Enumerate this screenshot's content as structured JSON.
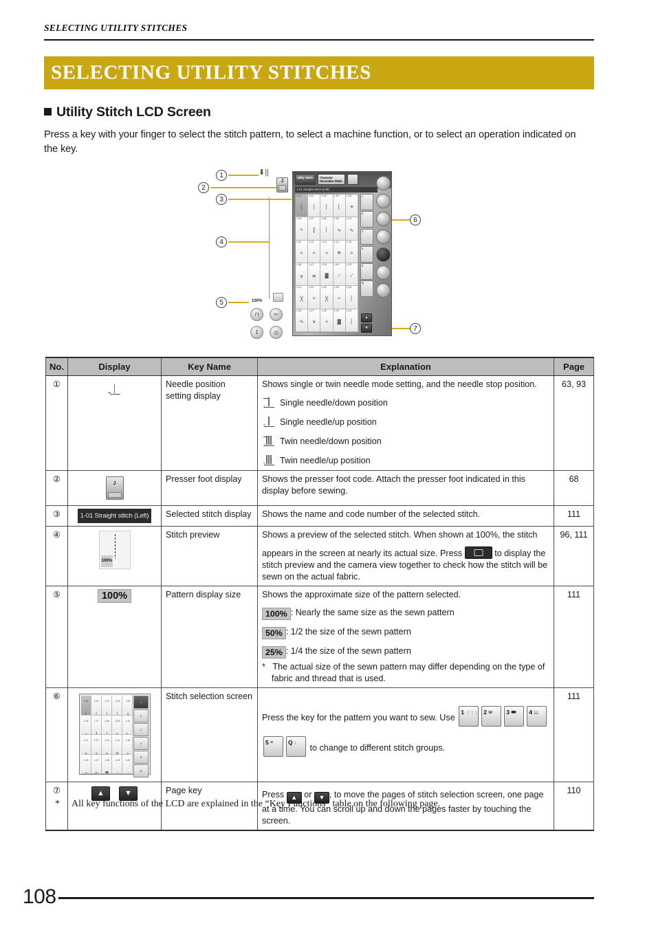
{
  "running_head": "SELECTING UTILITY STITCHES",
  "title_bar": {
    "text": "SELECTING UTILITY STITCHES",
    "color": "#c9a712"
  },
  "section": {
    "heading": "Utility Stitch LCD Screen",
    "intro": "Press a key with your finger to select the stitch pattern, to select a machine function, or to select an operation indicated on the key."
  },
  "diagram": {
    "callouts": [
      "1",
      "2",
      "3",
      "4",
      "5",
      "6",
      "7"
    ],
    "lcd": {
      "tab_utility": "Utility Stitch",
      "tab_character": "Character Decorative Stitch",
      "tab_icon": "bookmark-icon",
      "selected_stitch": "1-01 Straight stitch (Left)",
      "zoom_label": "100%",
      "stitch_codes": [
        "1-01",
        "1-02",
        "1-03",
        "1-04",
        "1-05",
        "1-06",
        "1-07",
        "1-08",
        "1-09",
        "1-10",
        "1-11",
        "1-12",
        "1-13",
        "1-14",
        "1-15",
        "1-16",
        "1-17",
        "1-18",
        "1-19",
        "1-20",
        "1-21",
        "1-22",
        "1-23",
        "1-24",
        "1-25",
        "1-26",
        "1-27",
        "1-28",
        "1-29",
        "1-30"
      ],
      "group_buttons": [
        "1",
        "2",
        "3",
        "4",
        "5",
        "Q"
      ],
      "page_up": "▲",
      "page_down": "▼"
    }
  },
  "table": {
    "headers": [
      "No.",
      "Display",
      "Key Name",
      "Explanation",
      "Page"
    ],
    "rows": [
      {
        "no": "①",
        "key_name": "Needle position setting display",
        "explanation_intro": "Shows single or twin needle mode setting, and the needle stop position.",
        "bullets": [
          "Single needle/down position",
          "Single needle/up position",
          "Twin needle/down position",
          "Twin needle/up position"
        ],
        "page": "63, 93"
      },
      {
        "no": "②",
        "key_name": "Presser foot display",
        "explanation_intro": "Shows the presser foot code. Attach the presser foot indicated in this display before sewing.",
        "page": "68"
      },
      {
        "no": "③",
        "key_name": "Selected stitch display",
        "display_badge": "1-01 Straight stitch (Left)",
        "explanation_intro": "Shows the name and code number of the selected stitch.",
        "page": "111"
      },
      {
        "no": "④",
        "key_name": "Stitch preview",
        "preview_label": "100%",
        "explanation_part1": "Shows a preview of the selected stitch. When shown at 100%, the stitch",
        "explanation_part2": "appears in the screen at nearly its actual size. Press",
        "explanation_part3": "to display the stitch preview and the camera view together to check how the stitch will be sewn on the actual fabric.",
        "camera_icon": "camera-icon",
        "page": "96, 111"
      },
      {
        "no": "⑤",
        "key_name": "Pattern display size",
        "display_badge": "100%",
        "explanation_intro": "Shows the approximate size of the pattern selected.",
        "sizes": [
          {
            "pill": "100%",
            "desc": ": Nearly the same size as the sewn pattern"
          },
          {
            "pill": "50%",
            "desc": ": 1/2 the size of the sewn pattern"
          },
          {
            "pill": "25%",
            "desc": ": 1/4 the size of the sewn pattern"
          }
        ],
        "note_star": "*",
        "note": "The actual size of the sewn pattern may differ depending on the type of fabric and thread that is used.",
        "page": "111"
      },
      {
        "no": "⑥",
        "key_name": "Stitch selection screen",
        "explanation_part1": "Press the key for the pattern you want to sew. Use",
        "explanation_part2": "to change to different stitch groups.",
        "group_keys": [
          "1",
          "2",
          "3",
          "4",
          "5",
          "Q"
        ],
        "mini_codes": [
          "1-01",
          "1-02",
          "1-03",
          "1-04",
          "1-05",
          "1-06",
          "1-07",
          "1-08",
          "1-09",
          "1-10",
          "1-11",
          "1-12",
          "1-13",
          "1-14",
          "1-15",
          "1-16",
          "1-17",
          "1-18",
          "1-19",
          "1-20"
        ],
        "page": "111"
      },
      {
        "no": "⑦",
        "key_name": "Page key",
        "explanation_part1": "Press",
        "explanation_part2": "or",
        "explanation_part3": ", to move the pages of stitch selection screen, one page at a time. You can scroll up and down the pages faster by touching the screen.",
        "arrow_up": "▲",
        "arrow_down": "▼",
        "page": "110"
      }
    ]
  },
  "footnote": {
    "star": "*",
    "text": "All key functions of the LCD are explained in the “Key Functions” table on the following page."
  },
  "page_number": "108"
}
